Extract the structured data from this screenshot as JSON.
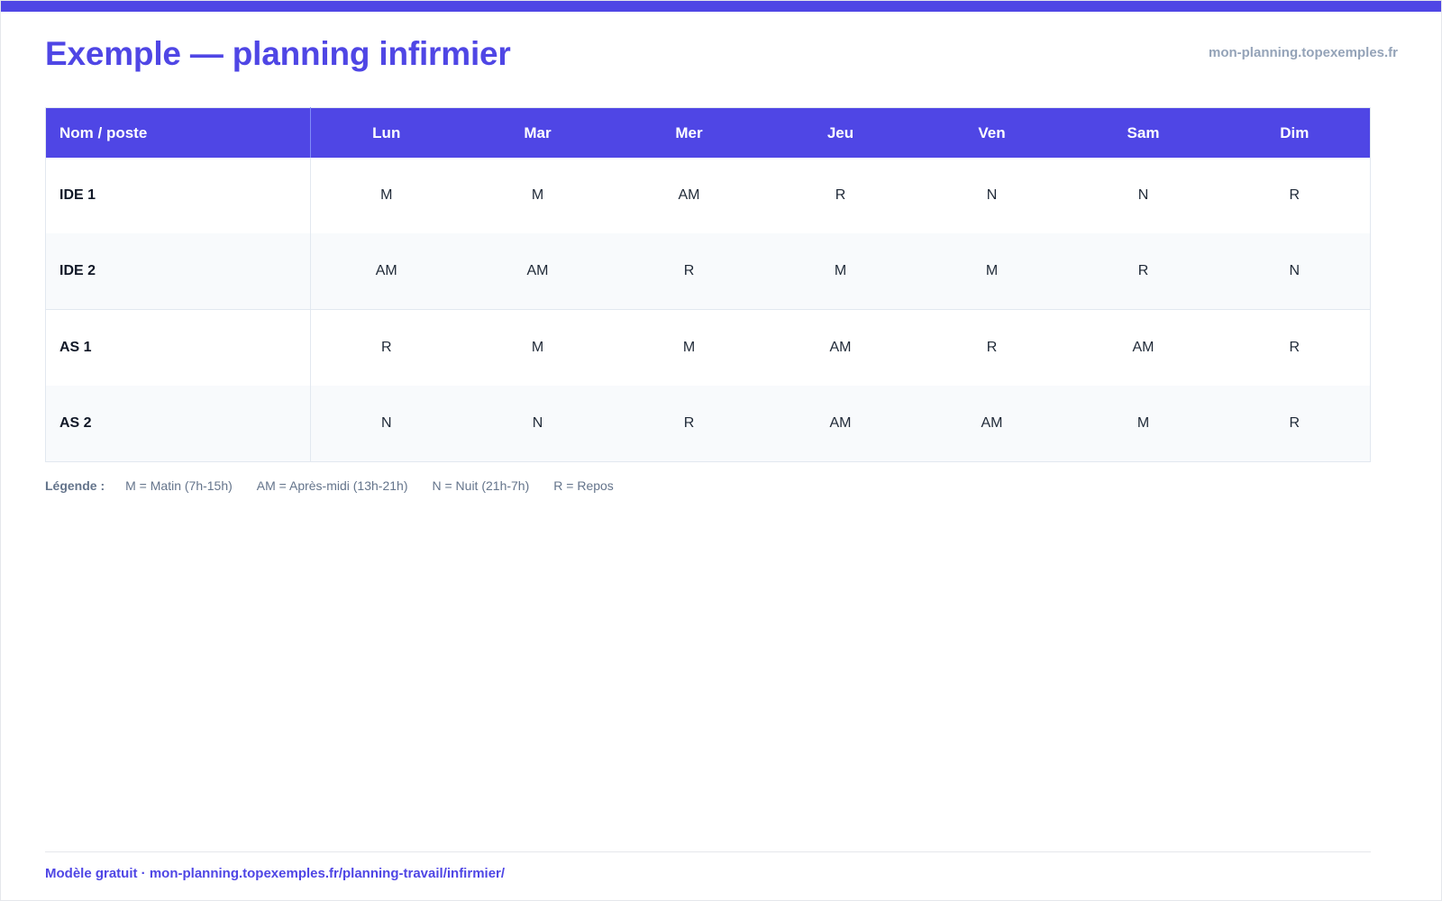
{
  "header": {
    "title": "Exemple — planning infirmier",
    "site": "mon-planning.topexemples.fr"
  },
  "table": {
    "name_header": "Nom / poste",
    "days": [
      "Lun",
      "Mar",
      "Mer",
      "Jeu",
      "Ven",
      "Sam",
      "Dim"
    ],
    "rows": [
      {
        "name": "IDE 1",
        "shifts": [
          "M",
          "M",
          "AM",
          "R",
          "N",
          "N",
          "R"
        ]
      },
      {
        "name": "IDE 2",
        "shifts": [
          "AM",
          "AM",
          "R",
          "M",
          "M",
          "R",
          "N"
        ]
      },
      {
        "name": "AS 1",
        "shifts": [
          "R",
          "M",
          "M",
          "AM",
          "R",
          "AM",
          "R"
        ]
      },
      {
        "name": "AS 2",
        "shifts": [
          "N",
          "N",
          "R",
          "AM",
          "AM",
          "M",
          "R"
        ]
      }
    ]
  },
  "legend": {
    "title": "Légende :",
    "items": [
      "M = Matin (7h-15h)",
      "AM = Après-midi (13h-21h)",
      "N = Nuit (21h-7h)",
      "R = Repos"
    ]
  },
  "footer": {
    "text": "Modèle gratuit · mon-planning.topexemples.fr/planning-travail/infirmier/"
  },
  "colors": {
    "accent": "#4f46e5",
    "muted": "#94a3b8",
    "row_alt": "#f8fafc"
  }
}
